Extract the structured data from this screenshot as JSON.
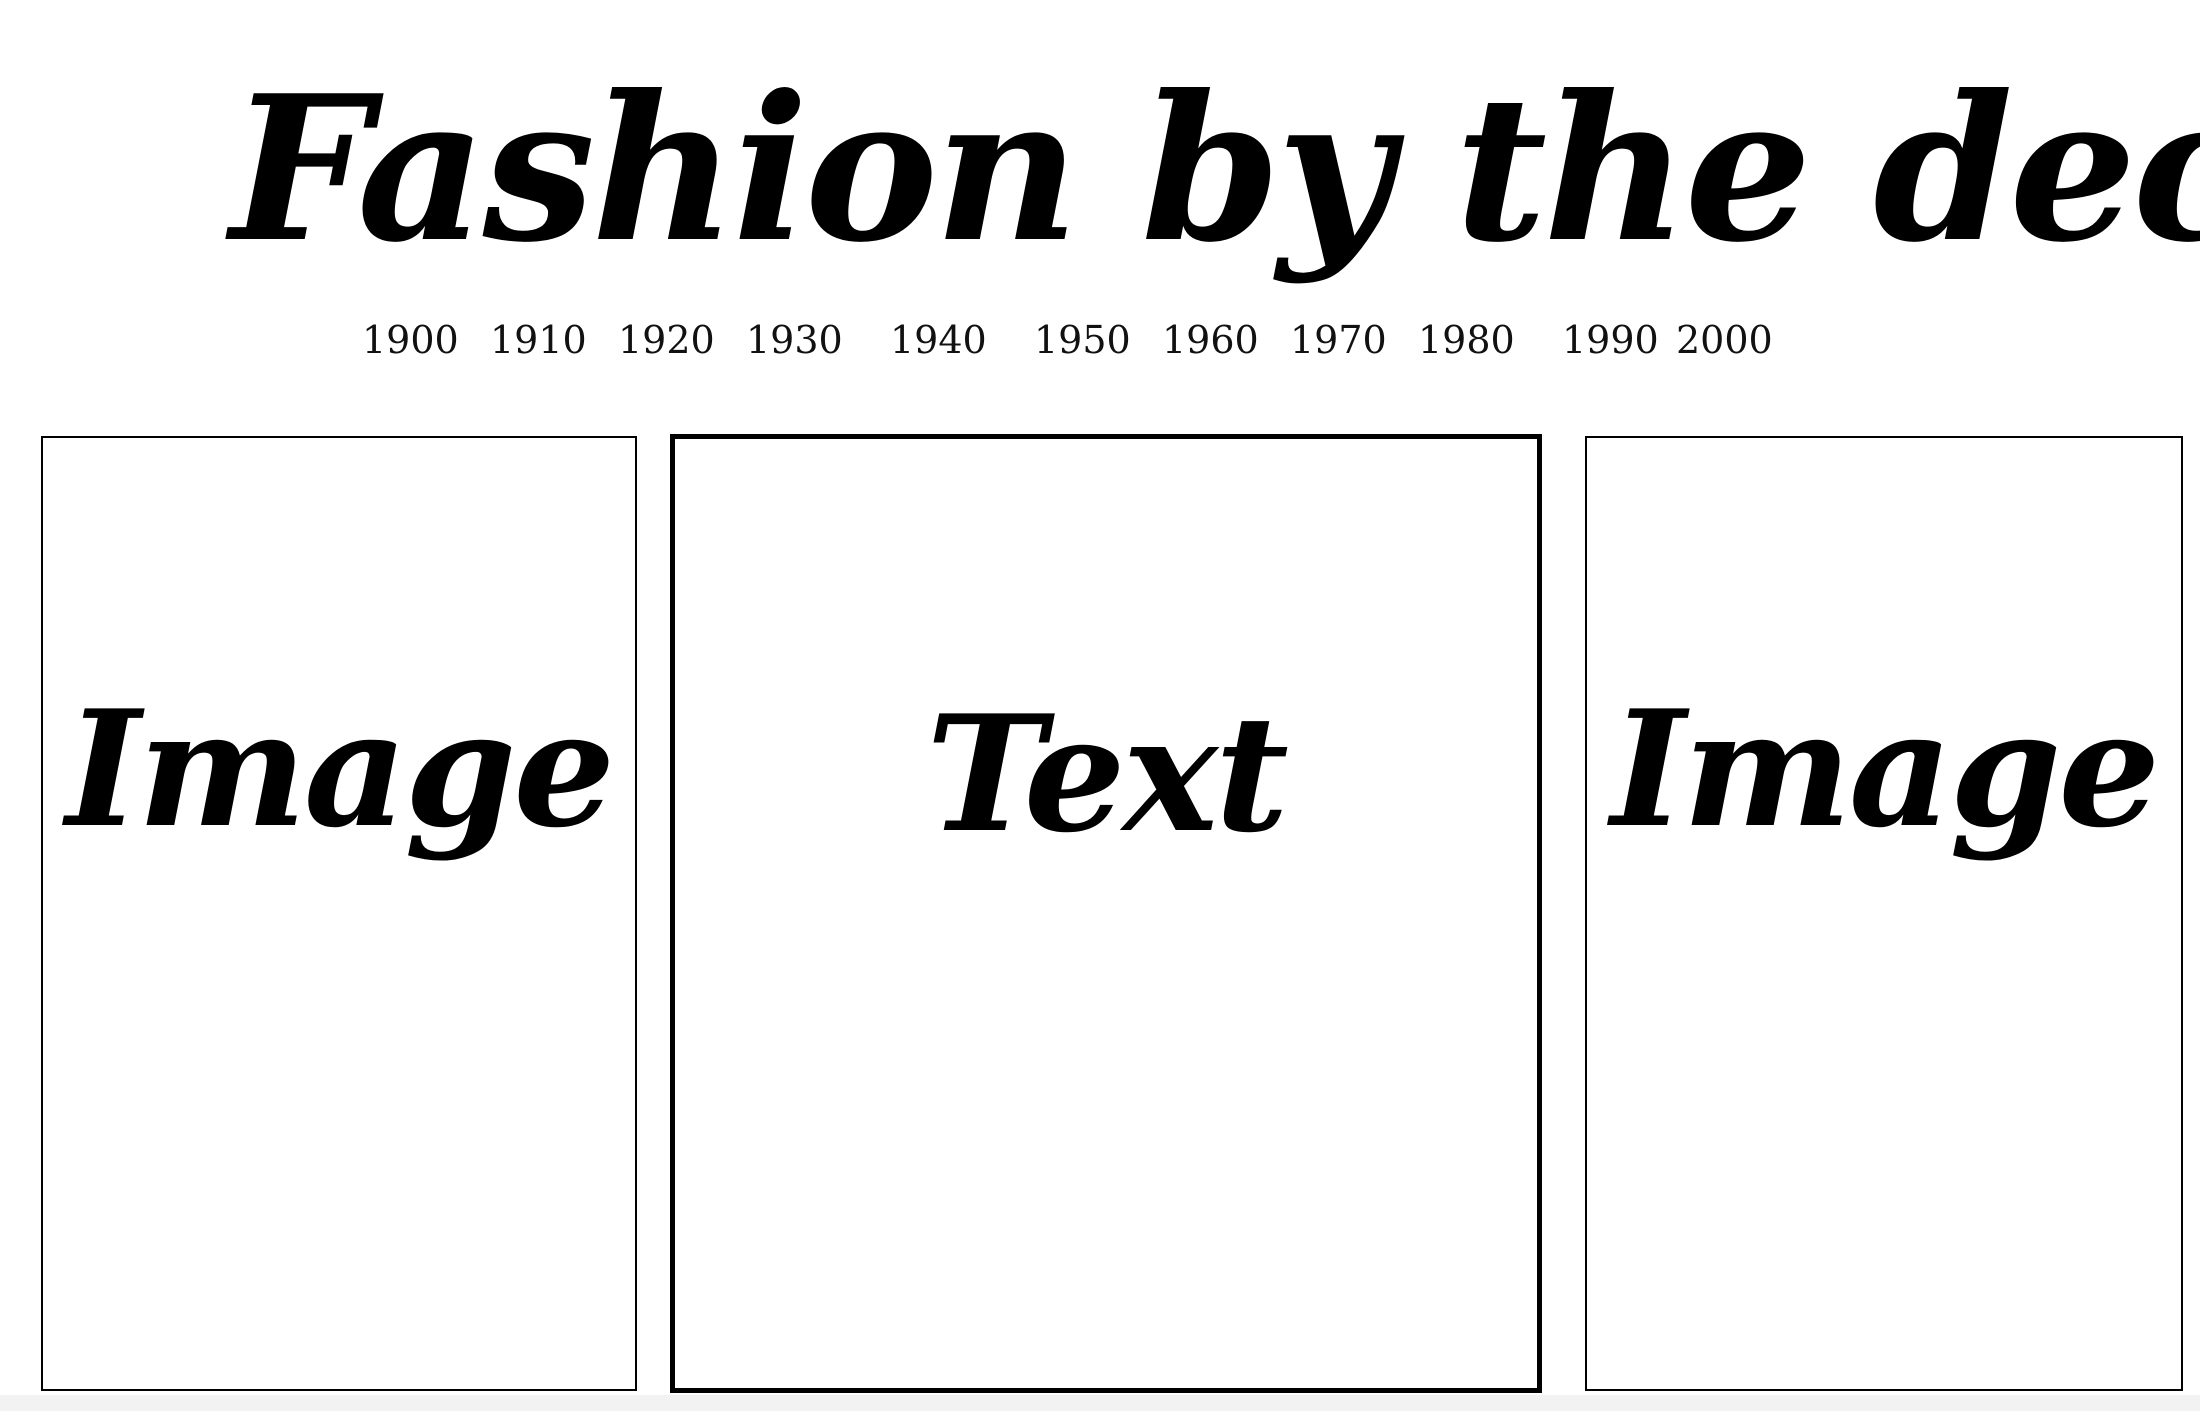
{
  "header": {
    "title": "Fashion by the decades"
  },
  "nav": {
    "decades": [
      "1900",
      "1910",
      "1920",
      "1930",
      "1940",
      "1950",
      "1960",
      "1970",
      "1980",
      "1990",
      "2000"
    ]
  },
  "panels": {
    "left": {
      "label": "Image"
    },
    "center": {
      "label": "Text"
    },
    "right": {
      "label": "Image"
    }
  },
  "colors": {
    "background": "#ffffff",
    "text": "#000000",
    "border": "#000000"
  }
}
